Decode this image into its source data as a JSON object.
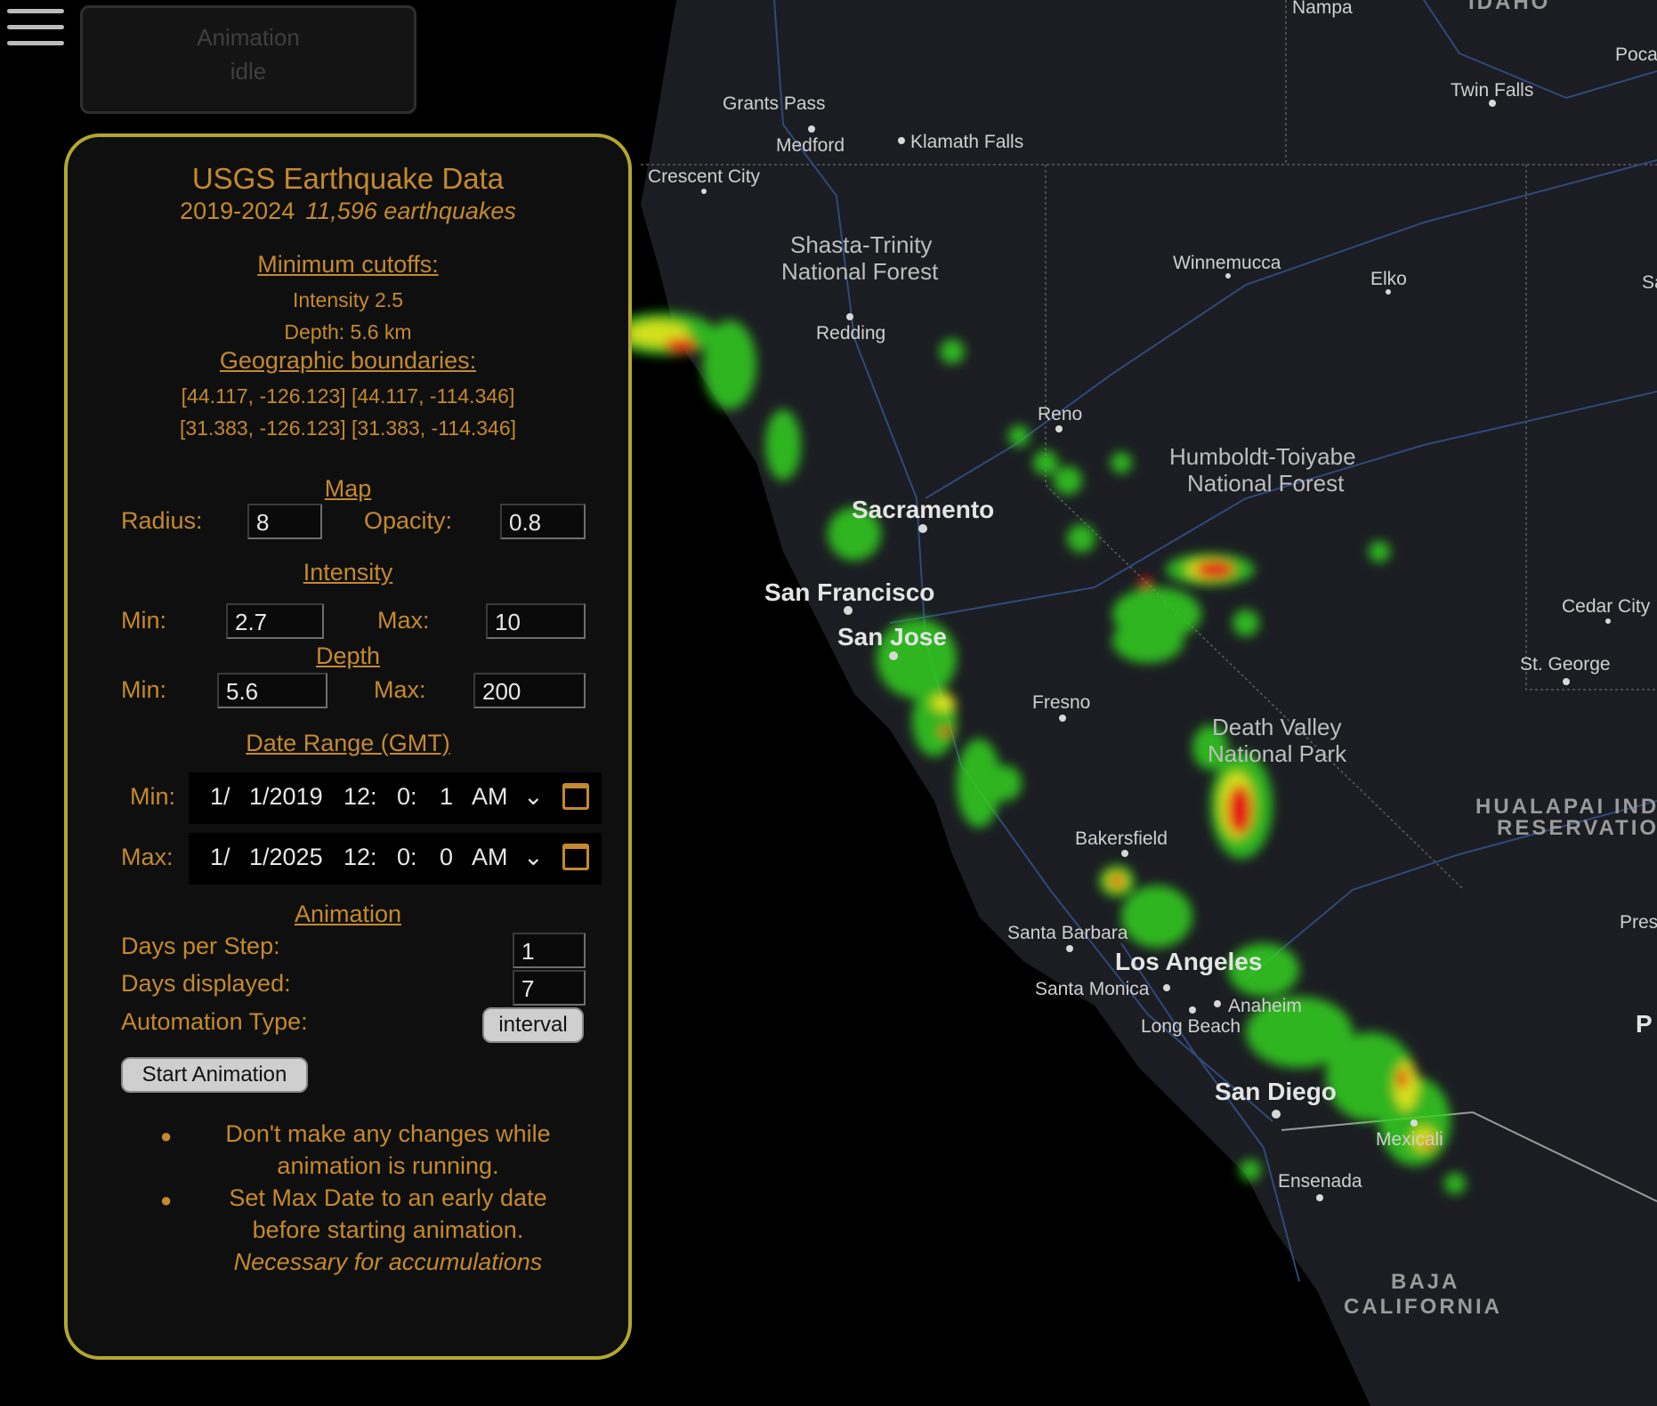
{
  "menu": {
    "icon": "hamburger-menu-icon"
  },
  "animation_status": {
    "title": "Animation",
    "state": "idle"
  },
  "panel": {
    "title": "USGS Earthquake Data",
    "years": "2019-2024",
    "count": "11,596 earthquakes",
    "min_cutoffs_heading": "Minimum cutoffs:",
    "intensity_cutoff": "Intensity 2.5",
    "depth_cutoff": "Depth: 5.6 km",
    "geo_heading": "Geographic boundaries:",
    "bounds_line1": "[44.117, -126.123] [44.117, -114.346]",
    "bounds_line2": "[31.383, -126.123] [31.383, -114.346]",
    "map_heading": "Map",
    "radius_label": "Radius:",
    "radius_value": "8",
    "opacity_label": "Opacity:",
    "opacity_value": "0.8",
    "intensity_heading": "Intensity",
    "intensity_min_label": "Min:",
    "intensity_min": "2.7",
    "intensity_max_label": "Max:",
    "intensity_max": "10",
    "depth_heading": "Depth",
    "depth_min_label": "Min:",
    "depth_min": "5.6",
    "depth_max_label": "Max:",
    "depth_max": "200",
    "date_heading": "Date Range (GMT)",
    "date_min_label": "Min:",
    "date_min": {
      "month": "1/",
      "day": "1/2019",
      "hour": "12:",
      "minute": "0:",
      "second": "1",
      "ampm": "AM"
    },
    "date_max_label": "Max:",
    "date_max": {
      "month": "1/",
      "day": "1/2025",
      "hour": "12:",
      "minute": "0:",
      "second": "0",
      "ampm": "AM"
    },
    "animation_heading": "Animation",
    "days_per_step_label": "Days per Step:",
    "days_per_step": "1",
    "days_displayed_label": "Days displayed:",
    "days_displayed": "7",
    "automation_label": "Automation Type:",
    "automation_value": "interval",
    "start_button": "Start Animation",
    "note1_line1": "Don't make any changes while",
    "note1_line2": "animation is running.",
    "note2_line1": "Set Max Date to an early date",
    "note2_line2": "before starting animation.",
    "note2_line3": "Necessary for accumulations"
  },
  "map": {
    "cities": {
      "nampa": "Nampa",
      "idaho": "IDAHO",
      "poca": "Poca",
      "twin_falls": "Twin Falls",
      "grants_pass": "Grants Pass",
      "medford": "Medford",
      "klamath_falls": "Klamath Falls",
      "crescent_city": "Crescent City",
      "shasta1": "Shasta-Trinity",
      "shasta2": "National Forest",
      "winnemucca": "Winnemucca",
      "elko": "Elko",
      "sa": "Sa",
      "redding": "Redding",
      "reno": "Reno",
      "humboldt1": "Humboldt-Toiyabe",
      "humboldt2": "National Forest",
      "sacramento": "Sacramento",
      "san_francisco": "San Francisco",
      "san_jose": "San Jose",
      "cedar_city": "Cedar City",
      "st_george": "St. George",
      "fresno": "Fresno",
      "death_valley1": "Death Valley",
      "death_valley2": "National Park",
      "hualapai1": "HUALAPAI INDIAN",
      "hualapai2": "RESERVATION",
      "bakersfield": "Bakersfield",
      "pres": "Pres",
      "santa_barbara": "Santa Barbara",
      "los_angeles": "Los Angeles",
      "santa_monica": "Santa Monica",
      "anaheim": "Anaheim",
      "long_beach": "Long Beach",
      "p": "P",
      "san_diego": "San Diego",
      "mexicali": "Mexicali",
      "ensenada": "Ensenada",
      "baja1": "BAJA",
      "baja2": "CALIFORNIA"
    }
  }
}
